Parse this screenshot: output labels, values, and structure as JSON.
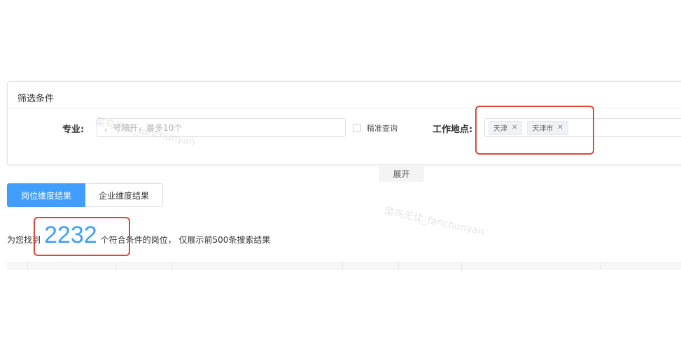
{
  "filter": {
    "title": "筛选条件",
    "major": {
      "label": "专业:",
      "placeholder": "、号隔开，最多10个",
      "value": ""
    },
    "exact_query_label": "精准查询",
    "location": {
      "label": "工作地点:",
      "tags": [
        "天津",
        "天津市"
      ]
    },
    "expand_label": "展开"
  },
  "tabs": [
    {
      "label": "岗位维度结果",
      "active": true
    },
    {
      "label": "企业维度结果",
      "active": false
    }
  ],
  "result": {
    "prefix": "为您找到",
    "count": "2232",
    "suffix": "个符合条件的岗位， 仅展示前500条搜索结果"
  },
  "watermarks": [
    "菜鸟无忧_fanchunyan",
    "菜鸟无忧_fanchunyan"
  ],
  "colors": {
    "accent": "#409eff",
    "annotation": "#e0453a"
  }
}
